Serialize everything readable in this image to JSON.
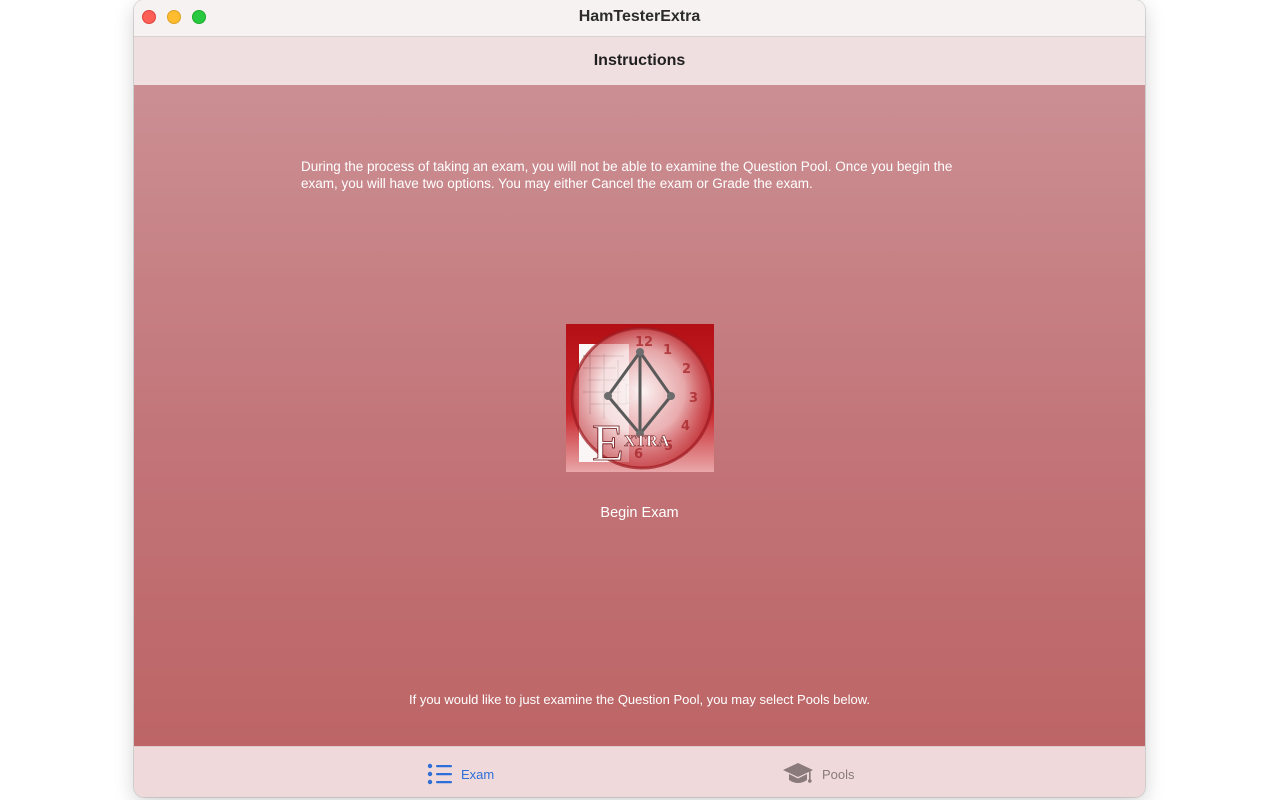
{
  "window": {
    "title": "HamTesterExtra"
  },
  "nav": {
    "title": "Instructions"
  },
  "content": {
    "intro": "During the process of taking an exam, you will not be able to examine the Question Pool. Once you begin the exam, you will have two options. You may either Cancel the exam or Grade the exam.",
    "logo_text": "EXTRA",
    "begin_label": "Begin Exam",
    "pools_hint": "If you would like to just examine the Question Pool, you may select Pools below."
  },
  "tabs": [
    {
      "label": "Exam",
      "icon": "list-bullet-icon",
      "selected": true
    },
    {
      "label": "Pools",
      "icon": "graduation-cap-icon",
      "selected": false
    }
  ],
  "colors": {
    "accent": "#2d6fd8",
    "inactive_tab": "#8a7a7b",
    "content_top": "#cb8f93",
    "content_bottom": "#bd6566",
    "logo_red": "#c21418"
  }
}
